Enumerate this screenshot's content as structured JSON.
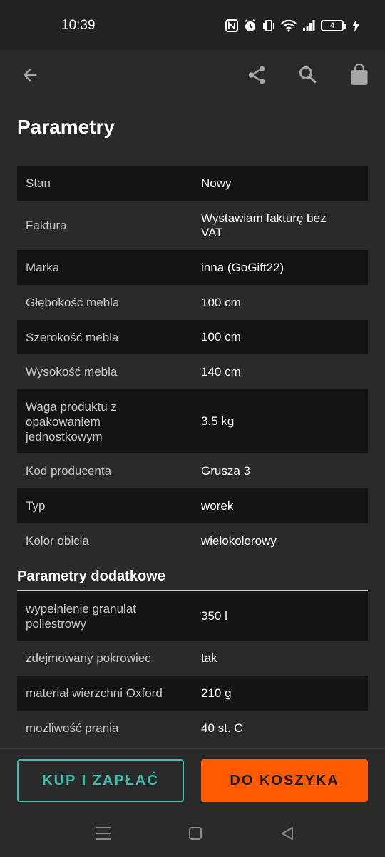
{
  "status_bar": {
    "time": "10:39",
    "battery_level": "4",
    "icons": [
      "nfc-icon",
      "alarm-icon",
      "vibrate-icon",
      "wifi-icon",
      "signal-icon",
      "battery-icon",
      "charging-icon"
    ]
  },
  "app_bar": {
    "icons": [
      "back-arrow-icon",
      "share-icon",
      "search-icon",
      "shopping-bag-icon"
    ]
  },
  "page": {
    "title": "Parametry"
  },
  "parameters": [
    {
      "label": "Stan",
      "value": "Nowy"
    },
    {
      "label": "Faktura",
      "value": "Wystawiam fakturę bez VAT"
    },
    {
      "label": "Marka",
      "value": "inna (GoGift22)"
    },
    {
      "label": "Głębokość mebla",
      "value": "100 cm"
    },
    {
      "label": "Szerokość mebla",
      "value": "100 cm"
    },
    {
      "label": "Wysokość mebla",
      "value": "140 cm"
    },
    {
      "label": "Waga produktu z opakowaniem jednostkowym",
      "value": "3.5 kg"
    },
    {
      "label": "Kod producenta",
      "value": "Grusza 3"
    },
    {
      "label": "Typ",
      "value": "worek"
    },
    {
      "label": "Kolor obicia",
      "value": "wielokolorowy"
    }
  ],
  "additional": {
    "title": "Parametry dodatkowe",
    "items": [
      {
        "label": "wypełnienie granulat poliestrowy",
        "value": "350 l"
      },
      {
        "label": "zdejmowany pokrowiec",
        "value": "tak"
      },
      {
        "label": "materiał wierzchni Oxford",
        "value": "210 g"
      },
      {
        "label": "mozliwość prania",
        "value": "40 st. C"
      }
    ]
  },
  "actions": {
    "buy_label": "KUP I ZAPŁAĆ",
    "cart_label": "DO KOSZYKA"
  },
  "colors": {
    "accent_teal": "#3dbfae",
    "accent_orange": "#ff5a00",
    "background": "#2a2a2a",
    "row_dark": "#141414"
  },
  "nav_bar": {
    "icons": [
      "menu-icon",
      "home-square-icon",
      "back-triangle-icon"
    ]
  }
}
